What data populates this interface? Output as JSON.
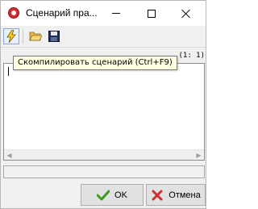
{
  "window": {
    "title": "Сценарий пра..."
  },
  "toolbar": {
    "compile_icon": "compile-lightning-icon",
    "open_icon": "open-folder-icon",
    "save_icon": "save-disk-icon"
  },
  "editor": {
    "position_text": "(1: 1)",
    "content": ""
  },
  "tooltip": {
    "text": "Скомпилировать сценарий (Ctrl+F9)"
  },
  "buttons": {
    "ok_label": "OK",
    "cancel_label": "Отмена"
  },
  "colors": {
    "ok_check": "#3d9b1f",
    "cancel_x": "#d22d2d",
    "app_icon": "#d9262d",
    "tooltip_bg": "#ffffe1"
  }
}
